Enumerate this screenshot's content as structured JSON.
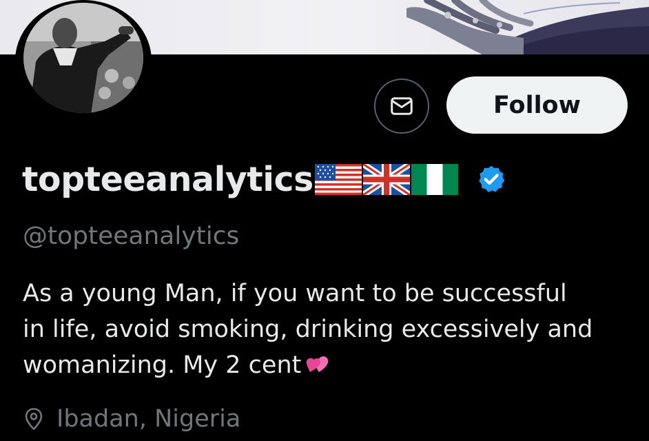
{
  "profile": {
    "display_name": "topteeanalytics",
    "flags": [
      "us-flag",
      "uk-flag",
      "nigeria-flag"
    ],
    "handle": "@topteeanalytics",
    "bio_lines": [
      "As a young Man, if you want to be successful",
      "in life, avoid smoking, drinking excessively and",
      "womanizing.  My 2 cent"
    ],
    "bio_emoji": "two-hearts-icon",
    "location": "Ibadan, Nigeria"
  },
  "actions": {
    "follow_label": "Follow",
    "message_icon": "mail-icon"
  },
  "colors": {
    "background": "#000000",
    "verified": "#1d9bf0",
    "follow_button_bg": "#eff3f4",
    "secondary_text": "#71767b"
  }
}
